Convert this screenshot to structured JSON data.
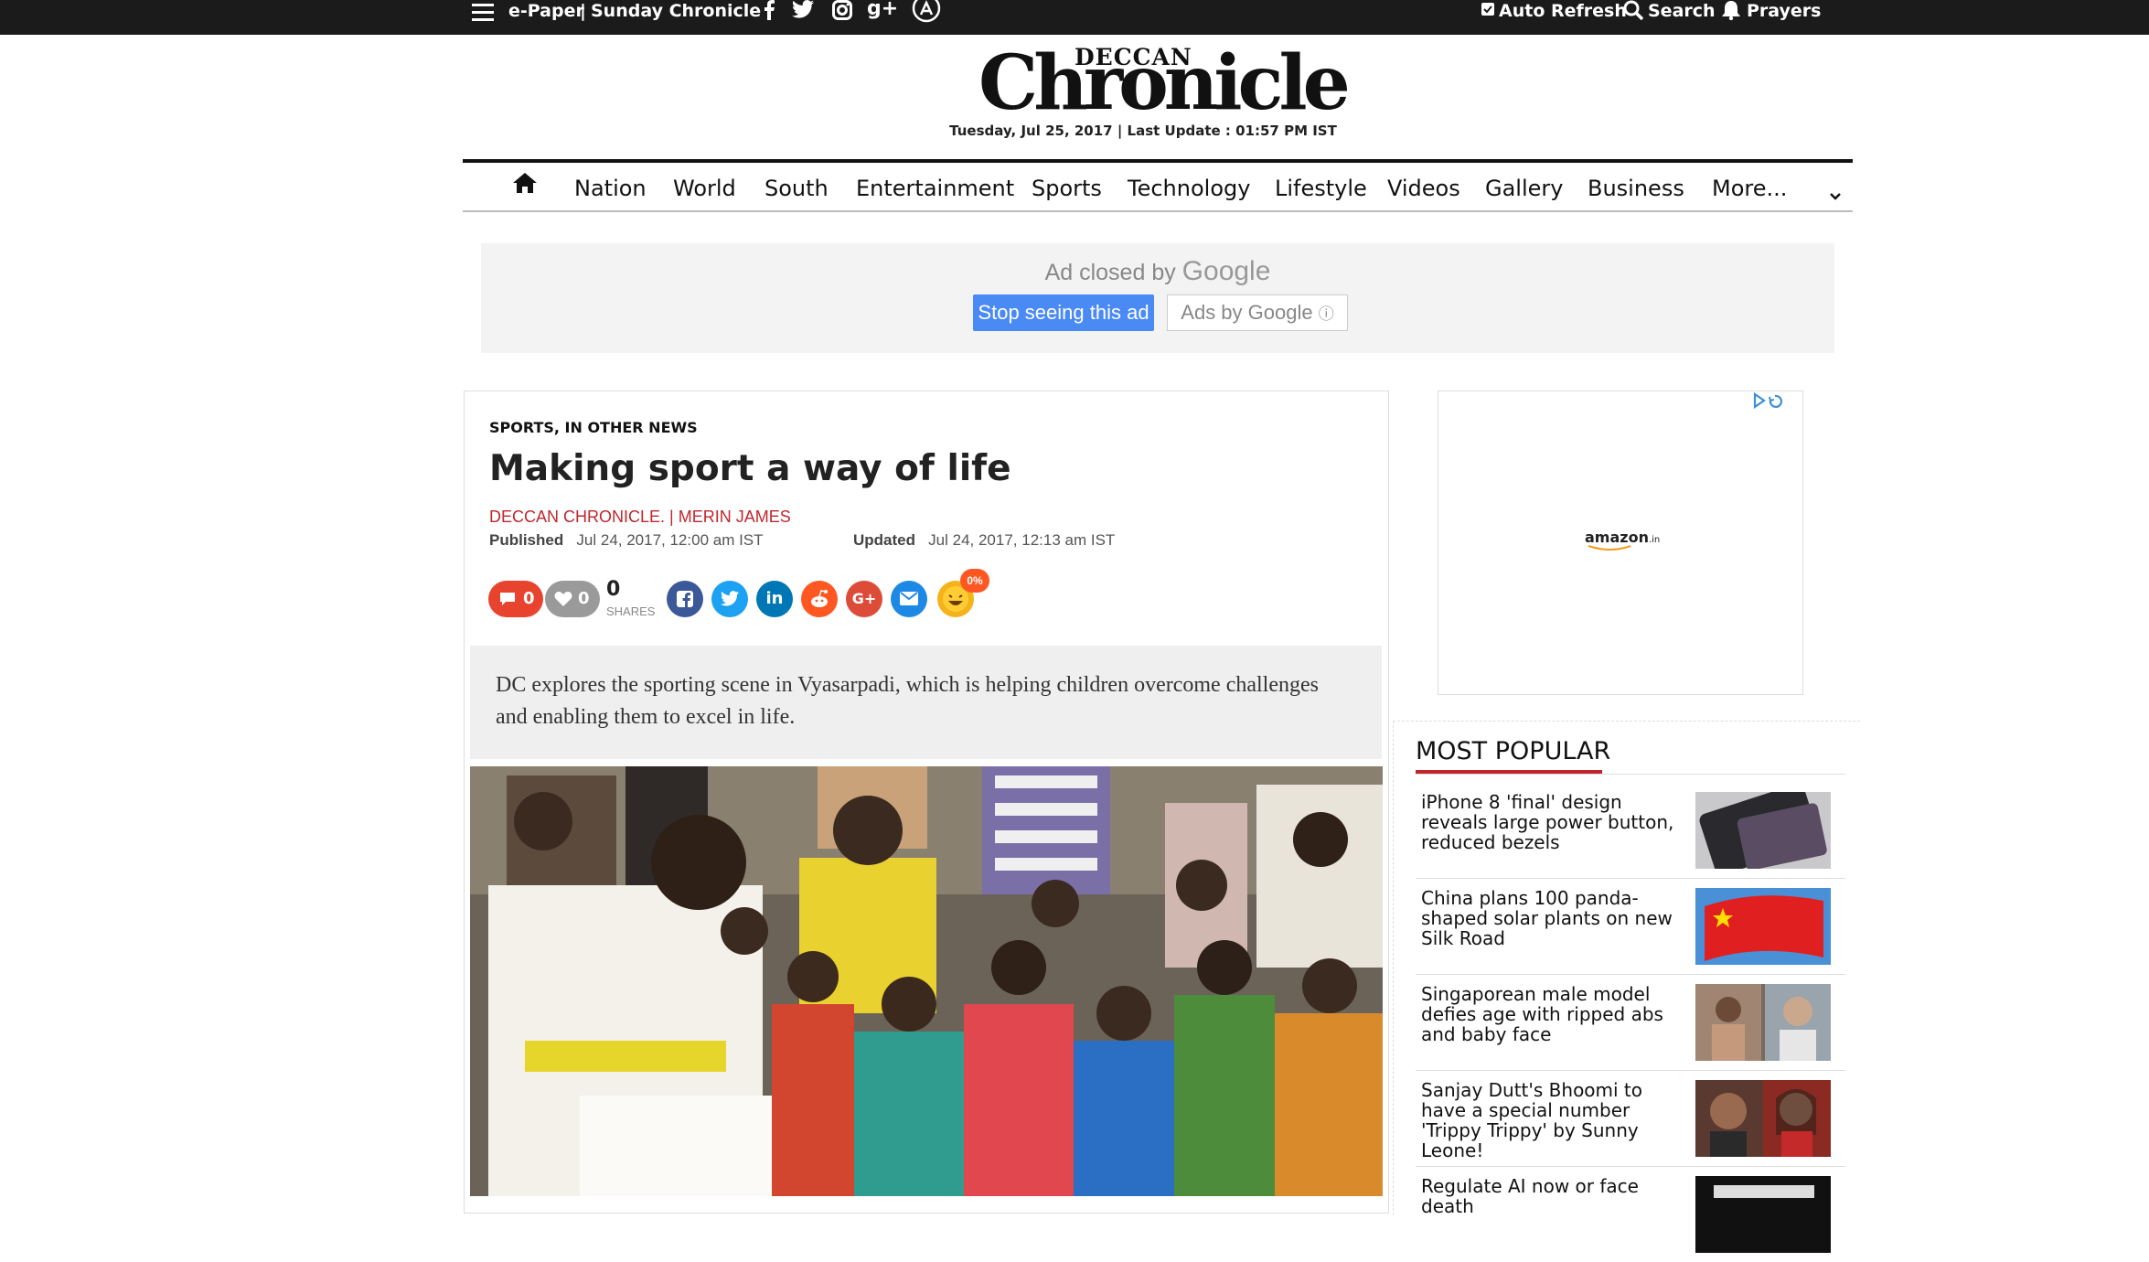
{
  "topbar": {
    "epaper": "e-Paper",
    "sunday": "Sunday Chronicle",
    "auto_refresh": "Auto Refresh",
    "search": "Search",
    "prayers": "Prayers",
    "social_icons": [
      "facebook-icon",
      "twitter-icon",
      "instagram-icon",
      "google-plus-icon",
      "app-store-icon"
    ]
  },
  "masthead": {
    "logo_small": "DECCAN",
    "logo_main": "Chronicle",
    "dateline": "Tuesday, Jul 25, 2017 | Last Update : 01:57 PM IST"
  },
  "nav": {
    "items": [
      "Nation",
      "World",
      "South",
      "Entertainment",
      "Sports",
      "Technology",
      "Lifestyle",
      "Videos",
      "Gallery",
      "Business",
      "More..."
    ]
  },
  "ad_banner": {
    "closed_text": "Ad closed by",
    "google": "Google",
    "stop_button": "Stop seeing this ad",
    "ads_by": "Ads by Google"
  },
  "article": {
    "category": "SPORTS, IN OTHER NEWS",
    "title": "Making sport a way of life",
    "byline": "DECCAN CHRONICLE. | MERIN JAMES",
    "published_label": "Published",
    "published": "Jul 24, 2017, 12:00 am IST",
    "updated_label": "Updated",
    "updated": "Jul 24, 2017, 12:13 am IST",
    "summary": "DC explores the sporting scene in Vyasarpadi, which is helping children overcome challenges and enabling them to excel in life."
  },
  "social": {
    "comments": "0",
    "likes": "0",
    "shares_count": "0",
    "shares_label": "SHARES",
    "reaction_badge": "0%",
    "colors": {
      "comments": "#e8432e",
      "likes": "#9a9a9a",
      "facebook": "#3b5998",
      "twitter": "#1da1f2",
      "linkedin": "#0077b5",
      "reddit": "#ff5722",
      "google": "#dd4b39",
      "email": "#1e88e5"
    }
  },
  "sidebar_ad": {
    "brand": "amazon",
    "brand_suffix": ".in"
  },
  "most_popular": {
    "title": "MOST POPULAR",
    "items": [
      {
        "title": "iPhone 8 'final' design reveals large power button, reduced bezels"
      },
      {
        "title": "China plans 100 panda-shaped solar plants on new Silk Road"
      },
      {
        "title": "Singaporean male model defies age with ripped abs and baby face"
      },
      {
        "title": "Sanjay Dutt's Bhoomi to have a special number 'Trippy Trippy' by Sunny Leone!"
      },
      {
        "title": "Regulate AI now or face death"
      }
    ]
  },
  "colors": {
    "accent": "#c0262d",
    "topbar": "#1b1b1b",
    "ad_button": "#4a8af4"
  }
}
